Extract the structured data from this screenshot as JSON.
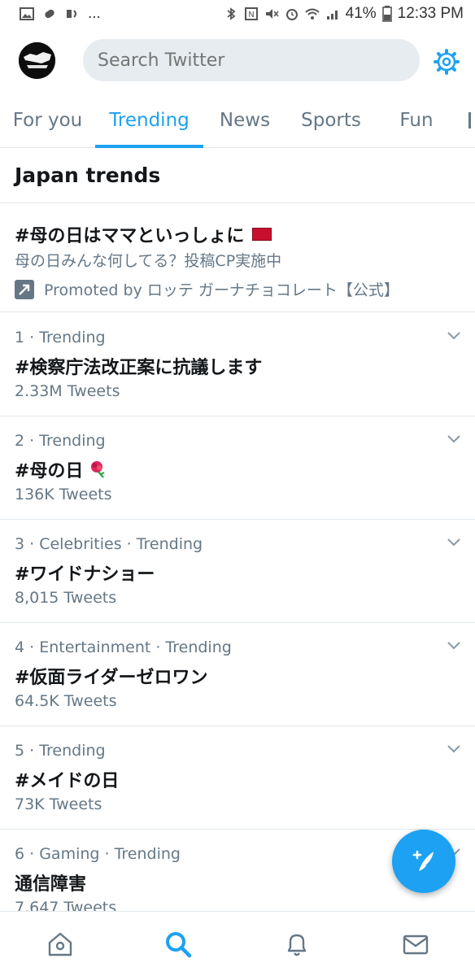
{
  "status_bar": {
    "battery": "41%",
    "time": "12:33 PM",
    "dots": "..."
  },
  "header": {
    "search_placeholder": "Search Twitter"
  },
  "tabs": [
    {
      "label": "For you",
      "active": false
    },
    {
      "label": "Trending",
      "active": true
    },
    {
      "label": "News",
      "active": false
    },
    {
      "label": "Sports",
      "active": false
    },
    {
      "label": "Fun",
      "active": false
    }
  ],
  "section_title": "Japan trends",
  "promoted": {
    "title": "#母の日はママといっしょに",
    "description": "母の日みんな何してる？投稿CP実施中",
    "promoted_by": "Promoted by ロッテ ガーナチョコレート【公式】"
  },
  "trends": [
    {
      "meta": "1 · Trending",
      "name": "#検察庁法改正案に抗議します",
      "count": "2.33M Tweets"
    },
    {
      "meta": "2 · Trending",
      "name": "#母の日",
      "count": "136K Tweets",
      "emoji": "🌹"
    },
    {
      "meta": "3 · Celebrities · Trending",
      "name": "#ワイドナショー",
      "count": "8,015 Tweets"
    },
    {
      "meta": "4 · Entertainment · Trending",
      "name": "#仮面ライダーゼロワン",
      "count": "64.5K Tweets"
    },
    {
      "meta": "5 · Trending",
      "name": "#メイドの日",
      "count": "73K Tweets"
    },
    {
      "meta": "6 · Gaming · Trending",
      "name": "通信障害",
      "count": "7,647 Tweets"
    }
  ],
  "colors": {
    "accent": "#1da1f2",
    "secondary_text": "#657786",
    "divider": "#e1e8ed"
  },
  "icons": {
    "settings": "gear-icon",
    "chevron": "chevron-down-icon",
    "compose": "compose-tweet-icon",
    "home": "home-icon",
    "search": "search-icon",
    "notifications": "bell-icon",
    "messages": "mail-icon",
    "promoted": "promoted-arrow-icon"
  }
}
